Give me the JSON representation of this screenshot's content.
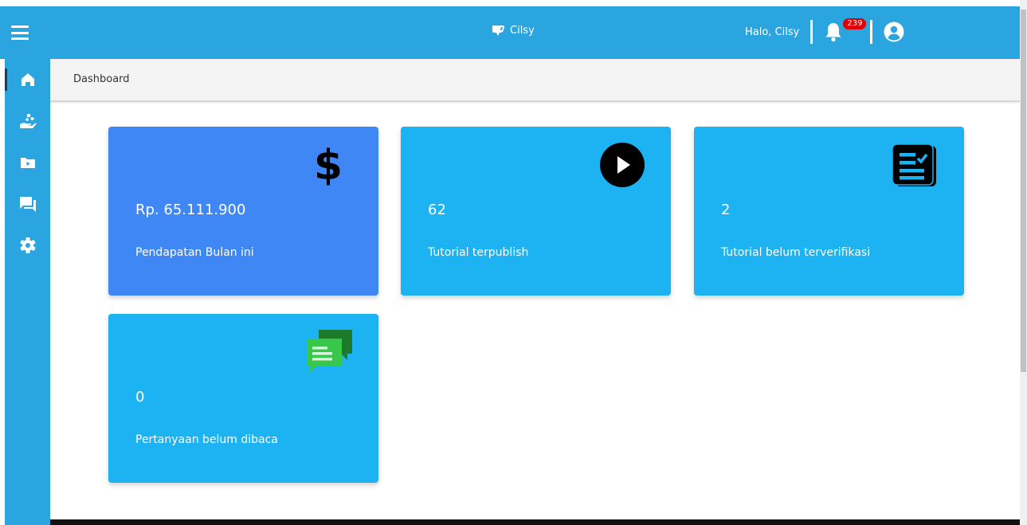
{
  "header": {
    "brand": "Cilsy",
    "greeting": "Halo, Cilsy",
    "notification_count": "239"
  },
  "breadcrumb": "Dashboard",
  "cards": [
    {
      "value": "Rp. 65.111.900",
      "label": "Pendapatan Bulan ini",
      "icon": "dollar-icon",
      "color": "#3f87f5"
    },
    {
      "value": "62",
      "label": "Tutorial terpublish",
      "icon": "play-circle-icon",
      "color": "#1db2f2"
    },
    {
      "value": "2",
      "label": "Tutorial belum terverifikasi",
      "icon": "checklist-icon",
      "color": "#1db2f2"
    },
    {
      "value": "0",
      "label": "Pertanyaan belum dibaca",
      "icon": "chat-icon",
      "color": "#1db2f2"
    }
  ],
  "sidebar": {
    "items": [
      "home-icon",
      "hand-coins-icon",
      "folder-video-icon",
      "forum-icon",
      "gear-icon"
    ]
  },
  "colors": {
    "topbar": "#2aa5e0",
    "accent_blue": "#3f87f5",
    "card_cyan": "#1db2f2",
    "badge": "#e00000"
  }
}
